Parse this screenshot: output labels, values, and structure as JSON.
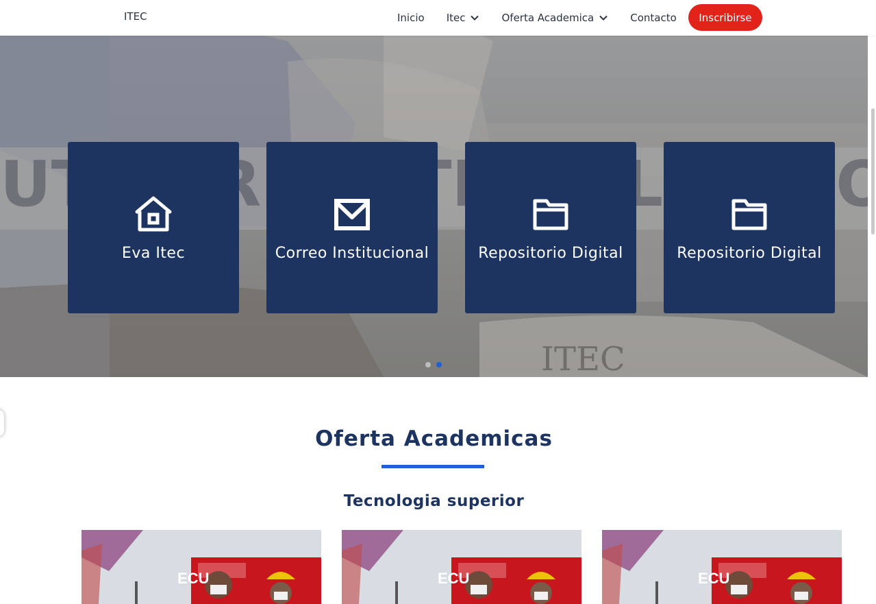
{
  "brand": "ITEC",
  "nav": {
    "items": [
      {
        "label": "Inicio",
        "dropdown": false
      },
      {
        "label": "Itec",
        "dropdown": true
      },
      {
        "label": "Oferta Academica",
        "dropdown": true
      },
      {
        "label": "Contacto",
        "dropdown": false
      }
    ],
    "cta_label": "Inscribirse"
  },
  "hero": {
    "cards": [
      {
        "label": "Eva Itec",
        "icon": "home-icon"
      },
      {
        "label": "Correo Institucional",
        "icon": "mail-icon"
      },
      {
        "label": "Repositorio Digital",
        "icon": "folder-icon"
      },
      {
        "label": "Repositorio Digital",
        "icon": "folder-icon"
      }
    ],
    "slides": 2,
    "active_slide": 2
  },
  "section": {
    "title": "Oferta Academicas",
    "subtitle": "Tecnologia superior"
  },
  "colors": {
    "primary_navy": "#1d3461",
    "accent_red": "#e2231a",
    "accent_blue": "#1e5fd6"
  }
}
